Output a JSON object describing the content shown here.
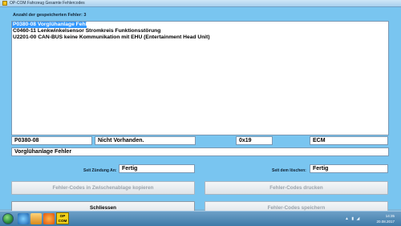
{
  "window": {
    "title": "OP-COM Fahrzeug Gesamte Fehlercodes"
  },
  "fault_count_label": "Anzahl der gespeicherten Fehler: 3",
  "faults": [
    "P0380-08 Vorglühanlage Fehler",
    "C0460-11 Lenkwinkelsensor Stromkreis Funktionsstörung",
    "U2201-00 CAN-BUS keine Kommunikation mit EHU (Entertainment Head Unit)"
  ],
  "selected_fault_index": 0,
  "details": {
    "code": "P0380-08",
    "status": "Nicht Vorhanden.",
    "hex": "0x19",
    "module": "ECM",
    "description": "Vorglühanlage Fehler",
    "since_ignition_label": "Seit Zündung An:",
    "since_ignition_value": "Fertig",
    "since_clear_label": "Seit dem löschen:",
    "since_clear_value": "Fertig"
  },
  "buttons": {
    "copy": "Fehler-Codes in Zwischenablage kopieren",
    "print": "Fehler-Codes drucken",
    "close": "Schliessen",
    "save": "Fehler-Codes speichern"
  },
  "taskbar": {
    "op_com_label_1": "OP",
    "op_com_label_2": "COM",
    "time": "14:35",
    "date": "20.08.2017"
  }
}
